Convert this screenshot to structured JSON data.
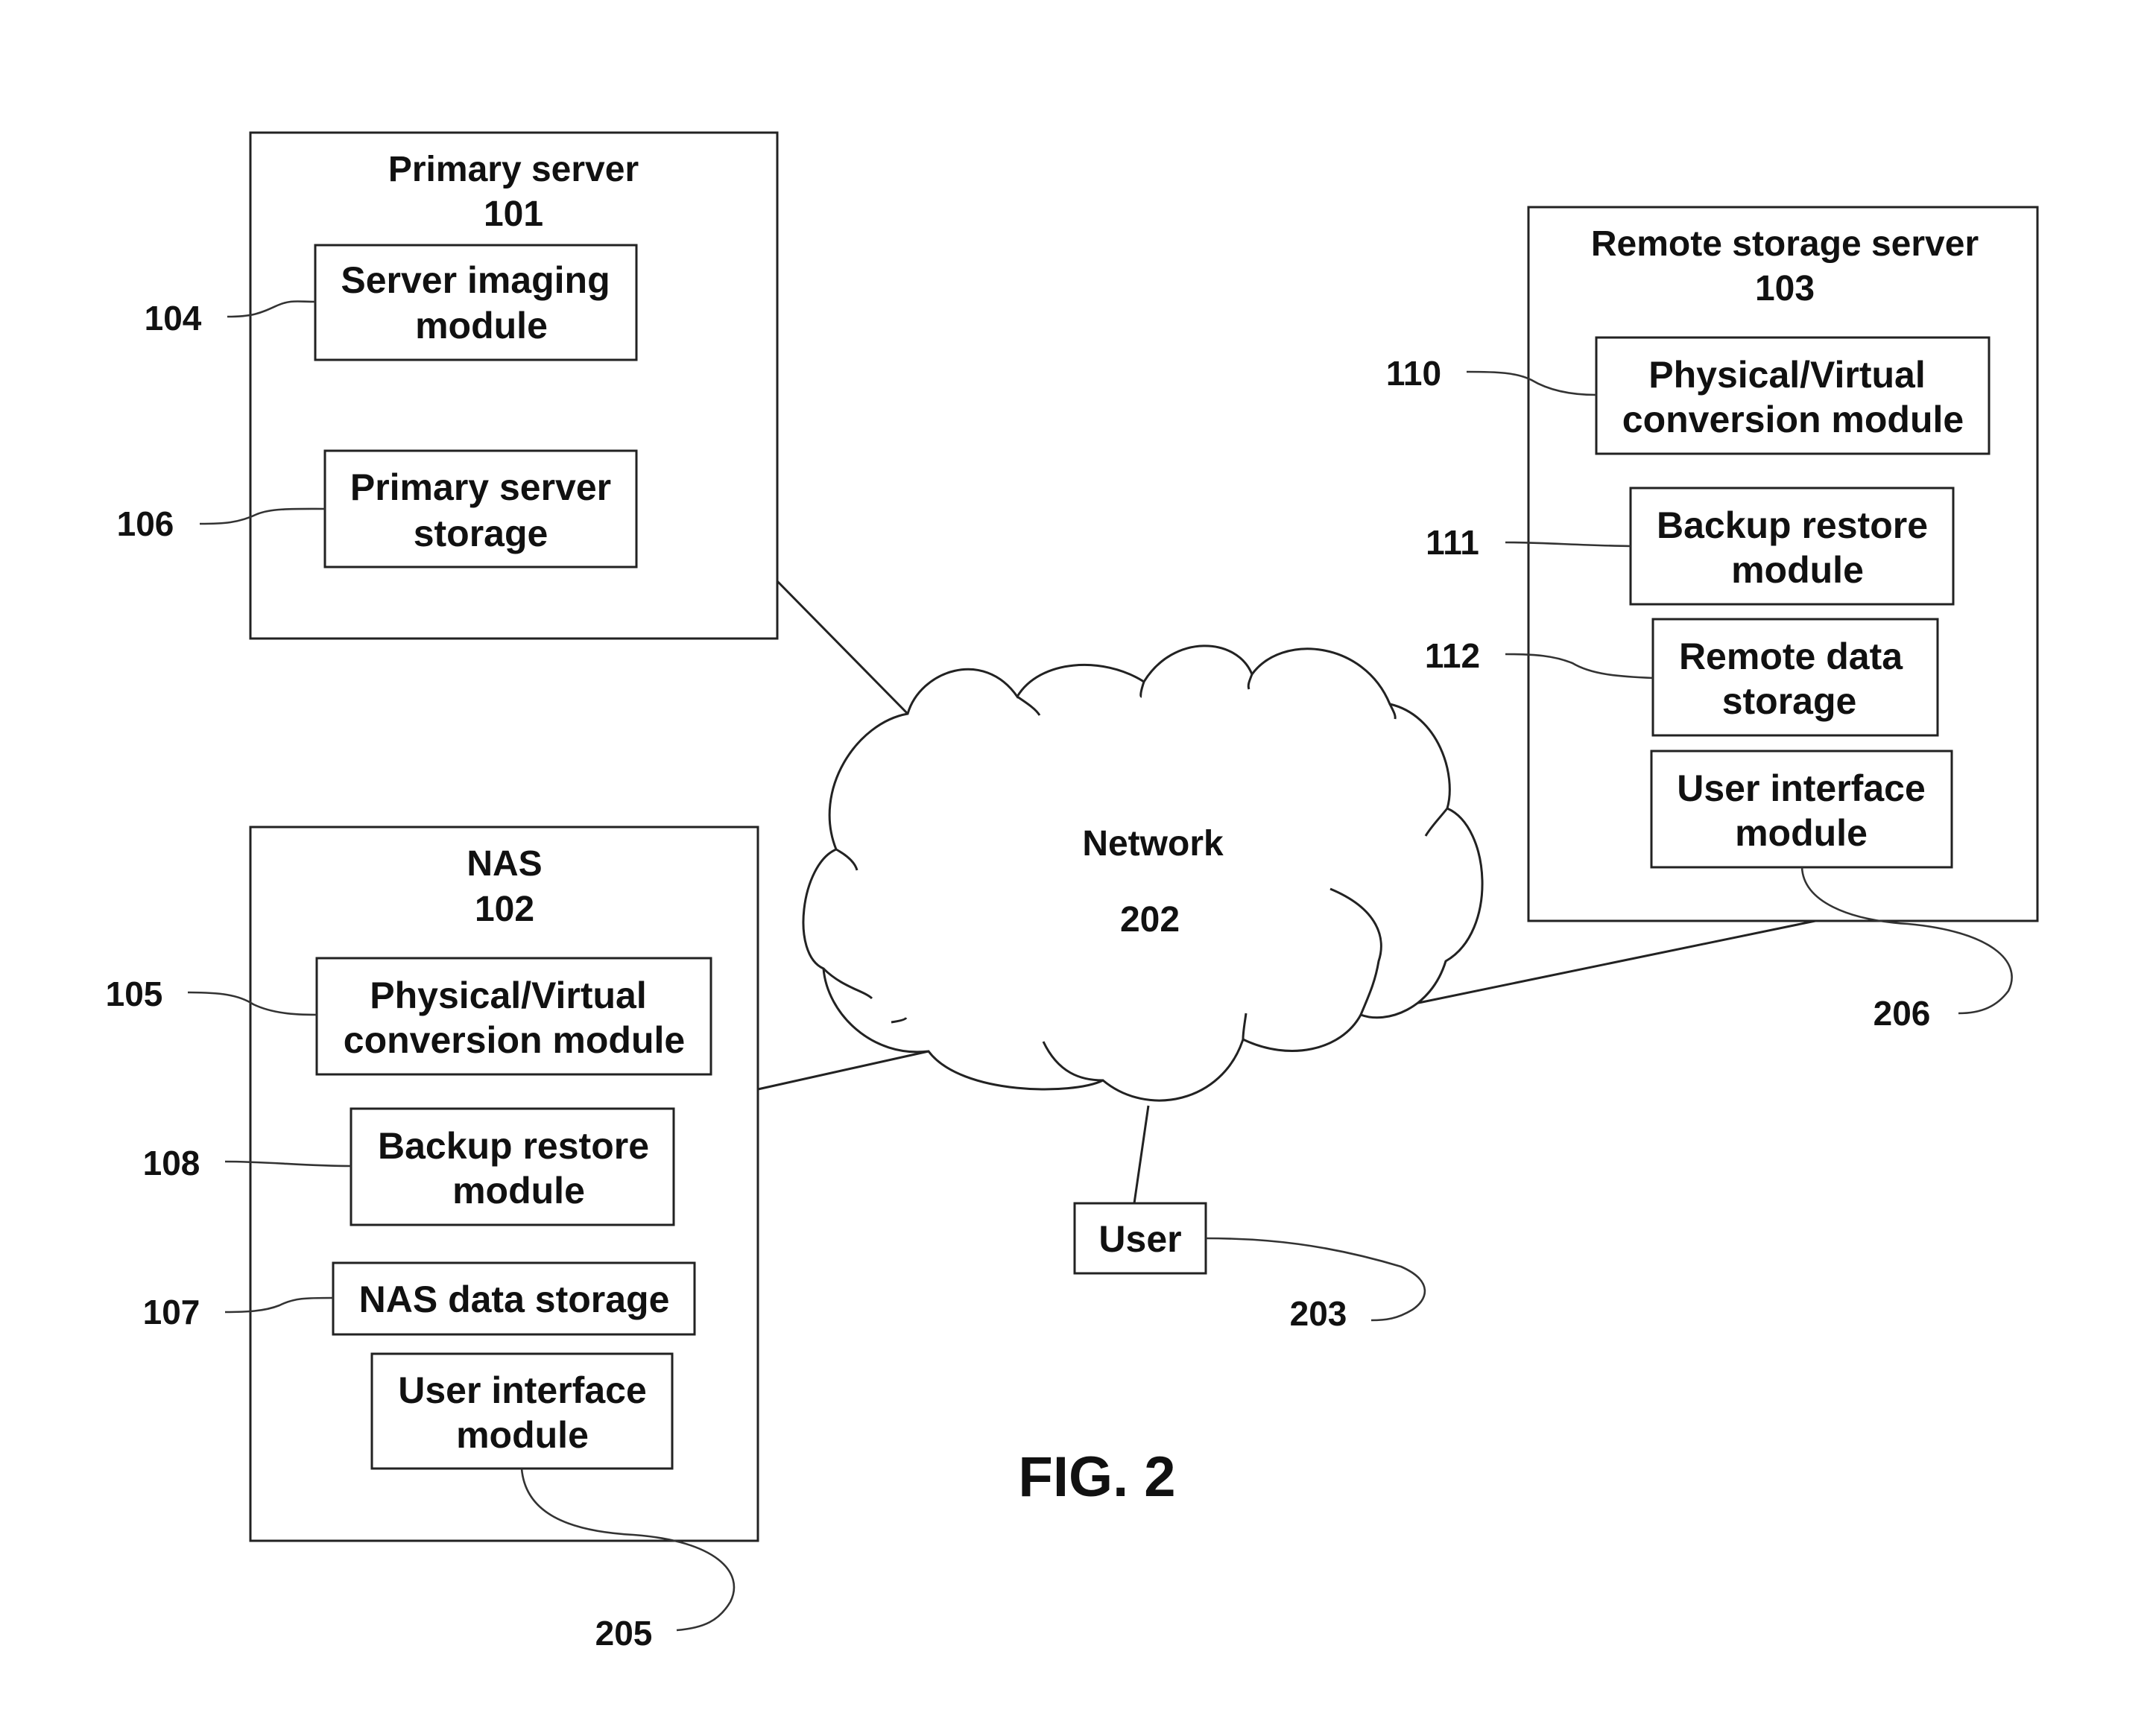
{
  "figure": {
    "label": "FIG. 2"
  },
  "primary_server": {
    "title": "Primary server",
    "ref": "101",
    "modules": [
      {
        "lines": [
          "Server imaging",
          "module"
        ],
        "ref": "104"
      },
      {
        "lines": [
          "Primary server",
          "storage"
        ],
        "ref": "106"
      }
    ]
  },
  "nas": {
    "title": "NAS",
    "ref": "102",
    "modules": [
      {
        "lines": [
          "Physical/Virtual",
          "conversion module"
        ],
        "ref": "105"
      },
      {
        "lines": [
          "Backup restore",
          "module"
        ],
        "ref": "108"
      },
      {
        "lines": [
          "NAS data storage"
        ],
        "ref": "107"
      },
      {
        "lines": [
          "User interface",
          "module"
        ],
        "ref": "205"
      }
    ]
  },
  "remote_server": {
    "title": "Remote storage server",
    "ref": "103",
    "modules": [
      {
        "lines": [
          "Physical/Virtual",
          "conversion module"
        ],
        "ref": "110"
      },
      {
        "lines": [
          "Backup restore",
          "module"
        ],
        "ref": "111"
      },
      {
        "lines": [
          "Remote data",
          "storage"
        ],
        "ref": "112"
      },
      {
        "lines": [
          "User interface",
          "module"
        ],
        "ref": "206"
      }
    ]
  },
  "network": {
    "title": "Network",
    "ref": "202"
  },
  "user": {
    "label": "User",
    "ref": "203"
  }
}
